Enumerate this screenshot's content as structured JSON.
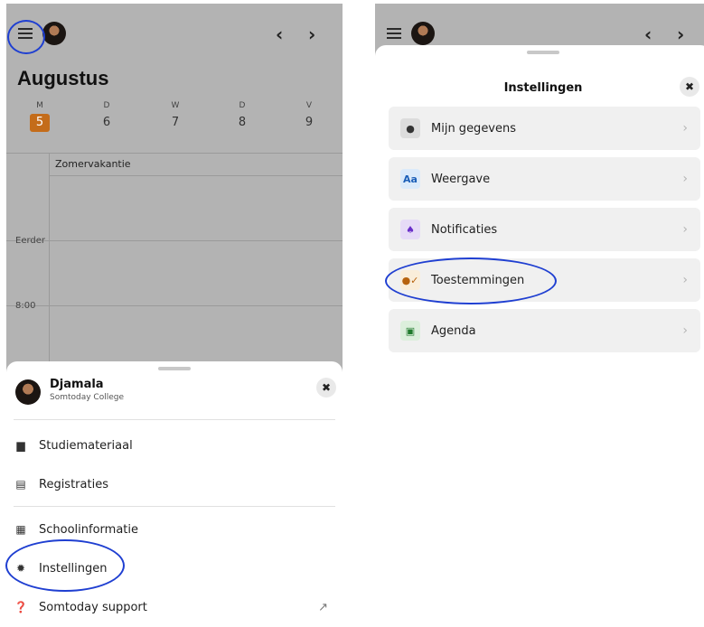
{
  "left": {
    "month": "Augustus",
    "days": [
      {
        "letter": "M",
        "num": "5",
        "today": true
      },
      {
        "letter": "D",
        "num": "6"
      },
      {
        "letter": "W",
        "num": "7"
      },
      {
        "letter": "D",
        "num": "8"
      },
      {
        "letter": "V",
        "num": "9"
      }
    ],
    "all_day_event": "Zomervakantie",
    "time_labels": [
      "Eerder",
      "8:00"
    ],
    "menu": {
      "user_name": "Djamala",
      "school": "Somtoday College",
      "items": [
        {
          "label": "Studiemateriaal",
          "icon": "book-icon"
        },
        {
          "label": "Registraties",
          "icon": "list-icon"
        },
        {
          "label": "Schoolinformatie",
          "icon": "school-icon"
        },
        {
          "label": "Instellingen",
          "icon": "gear-icon"
        },
        {
          "label": "Somtoday support",
          "icon": "help-icon"
        }
      ]
    }
  },
  "right": {
    "title": "Instellingen",
    "items": [
      {
        "label": "Mijn gegevens",
        "icon": "person-icon",
        "icon_bg": "#dcdcdc",
        "icon_color": "#333333",
        "glyph": "👤"
      },
      {
        "label": "Weergave",
        "icon": "text-size-icon",
        "icon_bg": "#dbeafa",
        "icon_color": "#1c5fb8",
        "glyph": "Aa"
      },
      {
        "label": "Notificaties",
        "icon": "bell-icon",
        "icon_bg": "#e6dbf7",
        "icon_color": "#6a2fc9",
        "glyph": "🔔"
      },
      {
        "label": "Toestemmingen",
        "icon": "consent-icon",
        "icon_bg": "#faeeda",
        "icon_color": "#b7630e",
        "glyph": "👤"
      },
      {
        "label": "Agenda",
        "icon": "calendar-icon",
        "icon_bg": "#dcefdc",
        "icon_color": "#1f7a2c",
        "glyph": "▣"
      }
    ]
  },
  "colors": {
    "highlight": "#1f3fd1",
    "today": "#c46c1a"
  }
}
